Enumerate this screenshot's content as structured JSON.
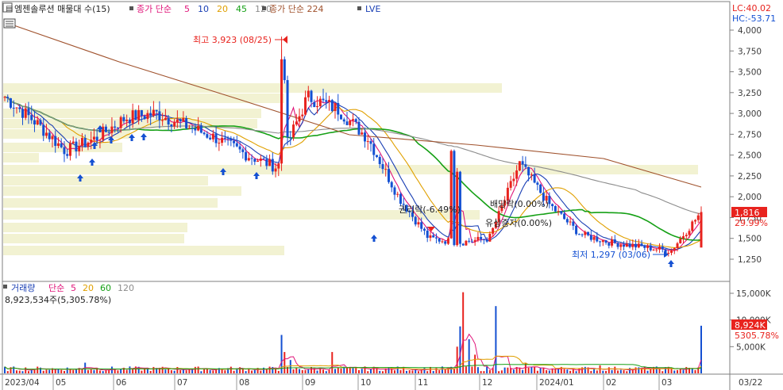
{
  "legend_price": {
    "title": "엠젠솔루션 매물대 수(15)",
    "ma_label": "종가 단순",
    "ma_periods": [
      "5",
      "10",
      "20",
      "45",
      "120"
    ],
    "ma_colors": [
      "#e0157a",
      "#1a3fb4",
      "#e0a000",
      "#15a015",
      "#8c8c8c"
    ],
    "ma2_label": "종가 단순 224",
    "ma2_color": "#a0522d",
    "lve": "LVE"
  },
  "legend_volume": {
    "title": "거래량",
    "ma_label": "단순",
    "ma_periods": [
      "5",
      "20",
      "60",
      "120"
    ],
    "ma_colors": [
      "#e0157a",
      "#e0a000",
      "#15a015",
      "#8c8c8c"
    ],
    "info": "8,923,534주(5,305.78%)"
  },
  "right_info": {
    "lc": "LC:40.02",
    "hc": "HC:-53.71"
  },
  "current": {
    "price": "1,816",
    "change": "29.99%",
    "volume": "8,924K",
    "vol_pct": "5305.78%"
  },
  "annotations": {
    "high": "최고 3,923 (08/25)",
    "low": "최저 1,297 (03/06)",
    "rights": "권리락(-6.49%)",
    "dividend": "배당락(0.00%)",
    "bonus": "유상증자(0.00%)"
  },
  "x_axis": {
    "labels": [
      "2023/04",
      "05",
      "06",
      "07",
      "08",
      "09",
      "10",
      "11",
      "12",
      "2024/01",
      "02",
      "03"
    ],
    "current_date": "03/22"
  },
  "colors": {
    "up": "#e8231e",
    "down": "#1450d2",
    "frame": "#7f7f7f",
    "volume_profile": "#f2f2d2"
  },
  "chart_data": [
    {
      "type": "candlestick",
      "title": "엠젠솔루션",
      "y_axis_ticks": [
        1250,
        1500,
        1750,
        2000,
        2250,
        2500,
        2750,
        3000,
        3250,
        3500,
        3750,
        4000
      ],
      "ylim": [
        1050,
        4150
      ],
      "x_months": [
        "2023/04",
        "05",
        "06",
        "07",
        "08",
        "09",
        "10",
        "11",
        "12",
        "2024/01",
        "02",
        "03"
      ],
      "approx_close_path": [
        [
          "2023/04",
          3200
        ],
        [
          "2023/04",
          2900
        ],
        [
          "05",
          2550
        ],
        [
          "05",
          2700
        ],
        [
          "06",
          2950
        ],
        [
          "06",
          3000
        ],
        [
          "07",
          2850
        ],
        [
          "07",
          2700
        ],
        [
          "08",
          2500
        ],
        [
          "08",
          2350
        ],
        [
          "08",
          3200
        ],
        [
          "09",
          3050
        ],
        [
          "09",
          2700
        ],
        [
          "10",
          2000
        ],
        [
          "10",
          1500
        ],
        [
          "11",
          1450
        ],
        [
          "11",
          1500
        ],
        [
          "11",
          2400
        ],
        [
          "12",
          1900
        ],
        [
          "12",
          1550
        ],
        [
          "2024/01",
          1450
        ],
        [
          "02",
          1400
        ],
        [
          "03",
          1350
        ],
        [
          "03/22",
          1816
        ]
      ],
      "high": 3923,
      "high_date": "08/25",
      "low": 1297,
      "low_date": "03/06",
      "last_close": 1816,
      "last_change_pct": 29.99,
      "moving_averages": [
        "5",
        "10",
        "20",
        "45",
        "120",
        "224"
      ]
    },
    {
      "type": "bar",
      "title": "거래량",
      "y_axis_ticks": [
        5000,
        10000,
        15000
      ],
      "y_unit": "K",
      "last_volume": 8923534,
      "last_volume_pct": 5305.78
    }
  ]
}
